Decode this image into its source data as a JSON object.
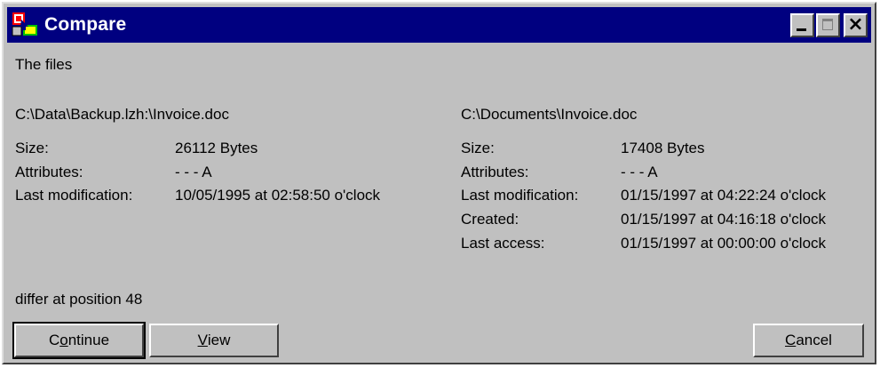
{
  "window": {
    "title": "Compare",
    "buttons": [
      "minimize",
      "maximize",
      "close"
    ]
  },
  "intro": "The files",
  "left_file": {
    "path": "C:\\Data\\Backup.lzh:\\Invoice.doc",
    "size_label": "Size:",
    "size_value": "26112 Bytes",
    "attributes_label": "Attributes:",
    "attributes_value": "- - - A",
    "modified_label": "Last modification:",
    "modified_value": "10/05/1995 at 02:58:50 o'clock"
  },
  "right_file": {
    "path": "C:\\Documents\\Invoice.doc",
    "size_label": "Size:",
    "size_value": "17408 Bytes",
    "attributes_label": "Attributes:",
    "attributes_value": "- - - A",
    "modified_label": "Last modification:",
    "modified_value": "01/15/1997 at 04:22:24 o'clock",
    "created_label": "Created:",
    "created_value": "01/15/1997 at 04:16:18 o'clock",
    "access_label": "Last access:",
    "access_value": "01/15/1997 at 00:00:00 o'clock"
  },
  "result": "differ at position 48",
  "actions": {
    "continue_pre": "C",
    "continue_key": "o",
    "continue_post": "ntinue",
    "view_pre": "",
    "view_key": "V",
    "view_post": "iew",
    "cancel_pre": "",
    "cancel_key": "C",
    "cancel_post": "ancel"
  }
}
